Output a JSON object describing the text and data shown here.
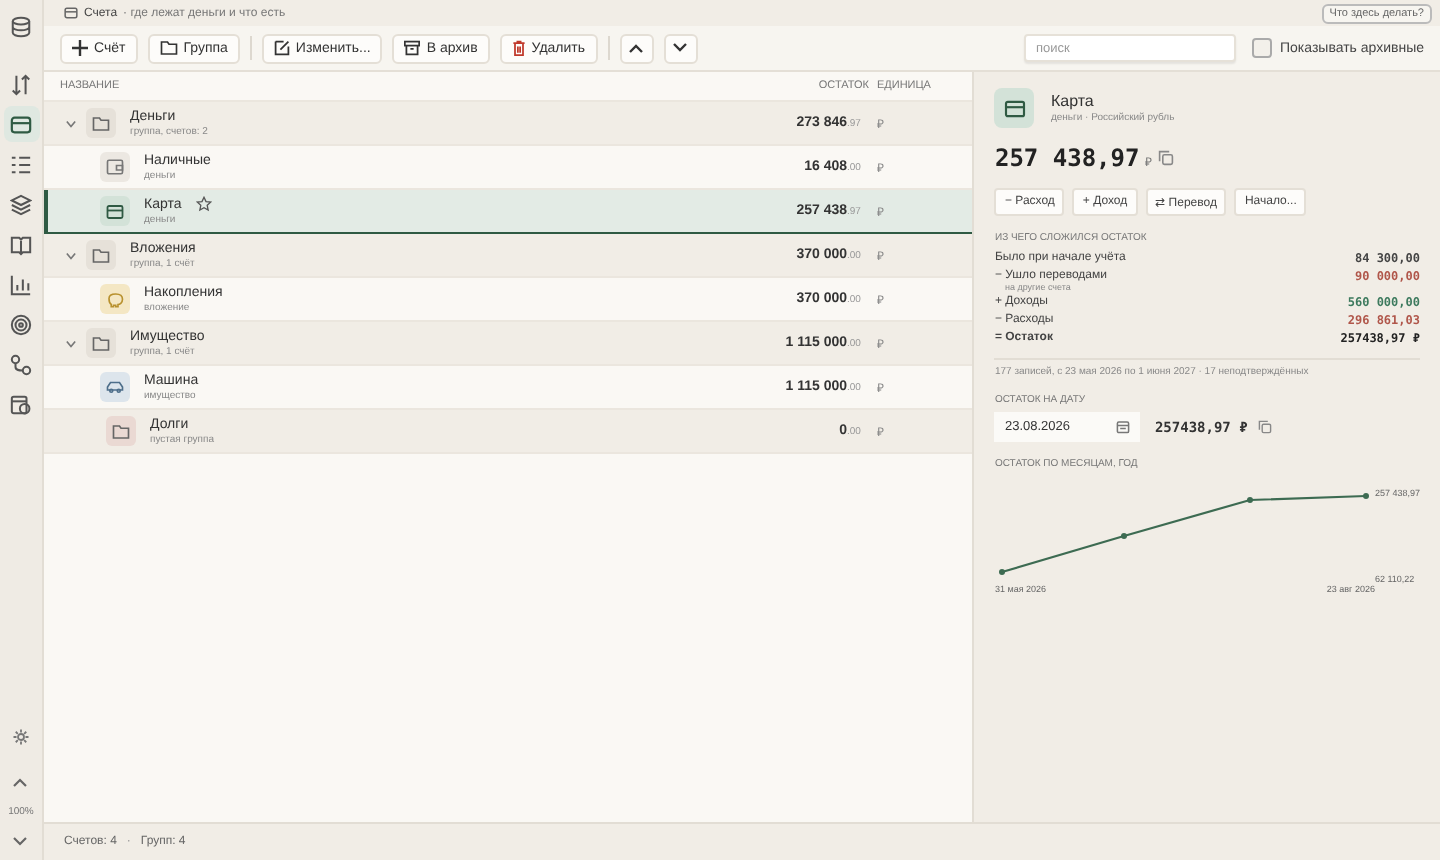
{
  "sidebar": {
    "items": [
      {
        "kind": "database",
        "selected": false
      },
      {
        "kind": "transfers",
        "selected": false
      },
      {
        "kind": "accounts",
        "selected": true
      },
      {
        "kind": "list",
        "selected": false
      },
      {
        "kind": "layers",
        "selected": false
      },
      {
        "kind": "book",
        "selected": false
      },
      {
        "kind": "chart",
        "selected": false
      },
      {
        "kind": "target",
        "selected": false
      },
      {
        "kind": "route",
        "selected": false
      },
      {
        "kind": "calendar",
        "selected": false
      }
    ],
    "zoom": "100%"
  },
  "breadcrumb": {
    "title": "Счета",
    "subtitle": "· где лежат деньги и что есть"
  },
  "help_button": "Что здесь делать?",
  "toolbar": {
    "buttons": [
      {
        "kind": "plus",
        "label": "Счёт"
      },
      {
        "kind": "folder",
        "label": "Группа"
      },
      {
        "kind": "edit",
        "label": "Изменить..."
      },
      {
        "kind": "archive",
        "label": "В архив"
      },
      {
        "kind": "delete",
        "label": "Удалить"
      }
    ],
    "search": {
      "placeholder": "поиск"
    },
    "show_archived": {
      "label": "Показывать архивные",
      "checked": false
    }
  },
  "table": {
    "columns": [
      "НАЗВАНИЕ",
      "ОСТАТОК",
      "ЕДИНИЦА"
    ],
    "rows": [
      {
        "name": "Деньги",
        "subtitle": "группа, счетов: 2",
        "amount": "273 846",
        "decimals": ".97",
        "unit": "₽",
        "expanded": true,
        "children": [
          {
            "kind": "cash",
            "name": "Наличные",
            "subtitle": "деньги",
            "amount": "16 408",
            "decimals": ".00",
            "unit": "₽",
            "selected": false,
            "favorite": false
          },
          {
            "kind": "card",
            "name": "Карта",
            "subtitle": "деньги",
            "amount": "257 438",
            "decimals": ".97",
            "unit": "₽",
            "selected": true,
            "favorite": true
          }
        ]
      },
      {
        "name": "Вложения",
        "subtitle": "группа, 1 счёт",
        "amount": "370 000",
        "decimals": ".00",
        "unit": "₽",
        "expanded": true,
        "children": [
          {
            "kind": "savings",
            "name": "Накопления",
            "subtitle": "вложение",
            "amount": "370 000",
            "decimals": ".00",
            "unit": "₽",
            "selected": false,
            "favorite": false
          }
        ]
      },
      {
        "name": "Имущество",
        "subtitle": "группа, 1 счёт",
        "amount": "1 115 000",
        "decimals": ".00",
        "unit": "₽",
        "expanded": true,
        "children": [
          {
            "kind": "car",
            "name": "Машина",
            "subtitle": "имущество",
            "amount": "1 115 000",
            "decimals": ".00",
            "unit": "₽",
            "selected": false,
            "favorite": false
          }
        ]
      },
      {
        "name": "Долги",
        "subtitle": "пустая группа",
        "amount": "0",
        "decimals": ".00",
        "unit": "₽"
      }
    ]
  },
  "status_bar": {
    "accounts": "Счетов: 4",
    "separator": "·",
    "groups": "Групп: 4"
  },
  "details": {
    "name": "Карта",
    "subtitle": "деньги · Российский рубль",
    "balance": "257 438,97",
    "unit": "₽",
    "actions": [
      "− Расход",
      "+ Доход",
      "⇄ Перевод",
      "Начало..."
    ],
    "breakdown_title": "ИЗ ЧЕГО СЛОЖИЛСЯ ОСТАТОК",
    "breakdown": [
      {
        "kind": "line",
        "label": "Было при начале учёта",
        "value": "84 300,00",
        "color": "#444444"
      },
      {
        "kind": "line",
        "label": "− Ушло переводами",
        "note": "на другие счета",
        "value": "90 000,00",
        "color": "#b0564a"
      },
      {
        "kind": "line",
        "label": "+ Доходы",
        "value": "560 000,00",
        "color": "#3d7a5e"
      },
      {
        "kind": "line",
        "label": "− Расходы",
        "value": "296 861,03",
        "color": "#b0564a"
      },
      {
        "kind": "total",
        "label": "= Остаток",
        "value": "257438,97 ₽",
        "color": "#222222"
      }
    ],
    "summary": "177 записей, с 23 мая 2026 по 1 июня 2027 · 17 неподтверждённых",
    "date_title": "ОСТАТОК НА ДАТУ",
    "date": "23.08.2026",
    "date_balance": "257438,97 ₽",
    "chart_title": "ОСТАТОК ПО МЕСЯЦАМ, ГОД",
    "chart": {
      "kind": "picture",
      "max_label": "257 438,97",
      "min_label": "62 110,22",
      "start_label": "31 мая 2026",
      "end_label": "23 авг 2026"
    }
  }
}
